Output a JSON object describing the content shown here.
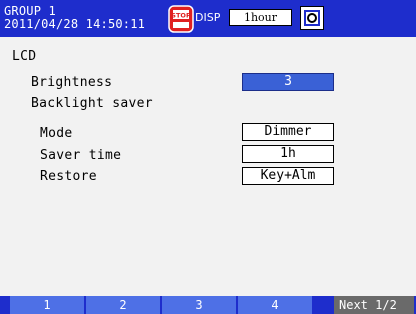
{
  "header": {
    "group_label": "GROUP 1",
    "datetime": "2011/04/28 14:50:11",
    "stop_icon_text": "STOP",
    "disp_label": "DISP",
    "disp_value": "1hour",
    "icons": {
      "stop": "stop-icon",
      "camera": "camera-icon"
    },
    "bg_color": "#1e2dcc"
  },
  "section": {
    "title": "LCD"
  },
  "settings": {
    "brightness": {
      "label": "Brightness",
      "value": "3"
    },
    "backlight_saver": {
      "label": "Backlight saver",
      "mode": {
        "label": "Mode",
        "value": "Dimmer"
      },
      "saver_time": {
        "label": "Saver time",
        "value": "1h"
      },
      "restore": {
        "label": "Restore",
        "value": "Key+Alm"
      }
    }
  },
  "softkeys": [
    {
      "label": "1"
    },
    {
      "label": "2"
    },
    {
      "label": "3"
    },
    {
      "label": "4"
    },
    {
      "label": "Next 1/2"
    }
  ],
  "colors": {
    "selected_field": "#3a61d6",
    "softkey": "#4e70e6",
    "softkey_next": "#6a6a6a",
    "stop_red": "#e02020"
  }
}
